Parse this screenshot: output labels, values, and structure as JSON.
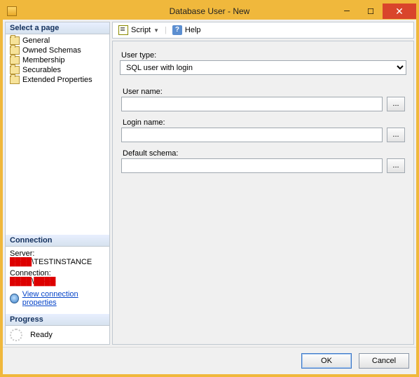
{
  "window": {
    "title": "Database User - New"
  },
  "sidebar": {
    "header": "Select a page",
    "items": [
      {
        "label": "General"
      },
      {
        "label": "Owned Schemas"
      },
      {
        "label": "Membership"
      },
      {
        "label": "Securables"
      },
      {
        "label": "Extended Properties"
      }
    ]
  },
  "connection": {
    "header": "Connection",
    "server_label": "Server:",
    "server_value": "\\TESTINSTANCE",
    "conn_label": "Connection:",
    "conn_value": "\\",
    "view_link": "View connection properties"
  },
  "progress": {
    "header": "Progress",
    "status": "Ready"
  },
  "toolbar": {
    "script": "Script",
    "help": "Help"
  },
  "form": {
    "usertype_label": "User type:",
    "usertype_value": "SQL user with login",
    "username_label": "User name:",
    "username_value": "",
    "loginname_label": "Login name:",
    "loginname_value": "",
    "defaultschema_label": "Default schema:",
    "defaultschema_value": "",
    "browse": "..."
  },
  "buttons": {
    "ok": "OK",
    "cancel": "Cancel"
  }
}
